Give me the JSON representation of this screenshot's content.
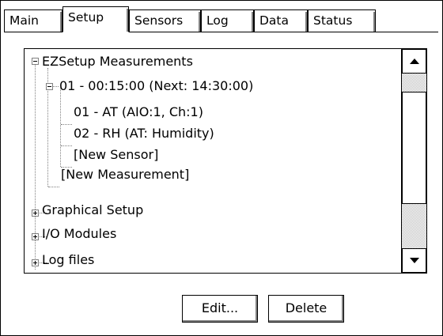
{
  "tabs": [
    {
      "label": "Main",
      "active": false
    },
    {
      "label": "Setup",
      "active": true
    },
    {
      "label": "Sensors",
      "active": false
    },
    {
      "label": "Log",
      "active": false
    },
    {
      "label": "Data",
      "active": false
    },
    {
      "label": "Status",
      "active": false
    }
  ],
  "tree": {
    "items": [
      {
        "label": "EZSetup Measurements",
        "expander": "minus"
      },
      {
        "label": "01 - 00:15:00 (Next: 14:30:00)",
        "expander": "minus"
      },
      {
        "label": "01 - AT (AIO:1, Ch:1)",
        "expander": "none"
      },
      {
        "label": "02 - RH (AT: Humidity)",
        "expander": "none"
      },
      {
        "label": "[New Sensor]",
        "expander": "none"
      },
      {
        "label": "[New Measurement]",
        "expander": "none"
      },
      {
        "label": "Graphical Setup",
        "expander": "plus"
      },
      {
        "label": "I/O Modules",
        "expander": "plus"
      },
      {
        "label": "Log files",
        "expander": "plus"
      }
    ]
  },
  "scrollbar": {
    "up_icon": "arrow-up-icon",
    "down_icon": "arrow-down-icon"
  },
  "buttons": {
    "edit": "Edit...",
    "delete": "Delete"
  }
}
